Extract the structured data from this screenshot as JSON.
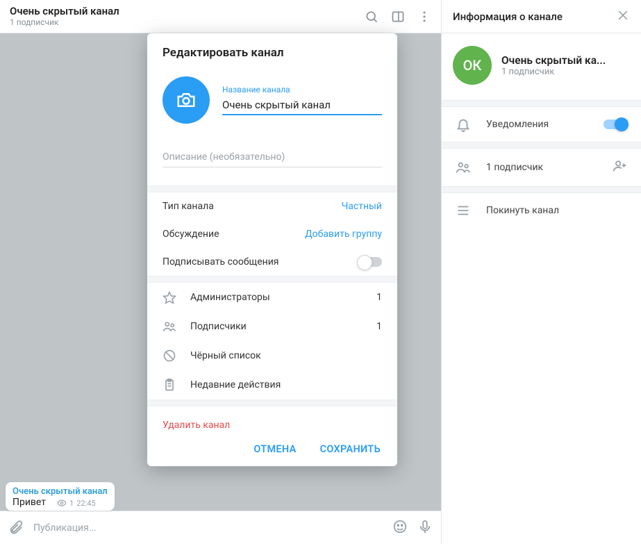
{
  "header": {
    "title": "Очень скрытый канал",
    "subtitle": "1 подписчик"
  },
  "message": {
    "sender": "Очень скрытый канал",
    "text": "Привет",
    "views": "1",
    "time": "22:45"
  },
  "compose": {
    "placeholder": "Публикация..."
  },
  "modal": {
    "title": "Редактировать канал",
    "name_label": "Название канала",
    "name_value": "Очень скрытый канал",
    "desc_placeholder": "Описание (необязательно)",
    "type_label": "Тип канала",
    "type_value": "Частный",
    "discussion_label": "Обсуждение",
    "discussion_value": "Добавить группу",
    "sign_label": "Подписывать сообщения",
    "admins_label": "Администраторы",
    "admins_count": "1",
    "subs_label": "Подписчики",
    "subs_count": "1",
    "blacklist_label": "Чёрный список",
    "recent_label": "Недавние действия",
    "delete_label": "Удалить канал",
    "cancel": "ОТМЕНА",
    "save": "СОХРАНИТЬ"
  },
  "info": {
    "title": "Информация о канале",
    "avatar_initials": "ОК",
    "channel_name": "Очень скрытый ка...",
    "subtitle": "1 подписчик",
    "notifications_label": "Уведомления",
    "subscribers_label": "1 подписчик",
    "leave_label": "Покинуть канал"
  }
}
